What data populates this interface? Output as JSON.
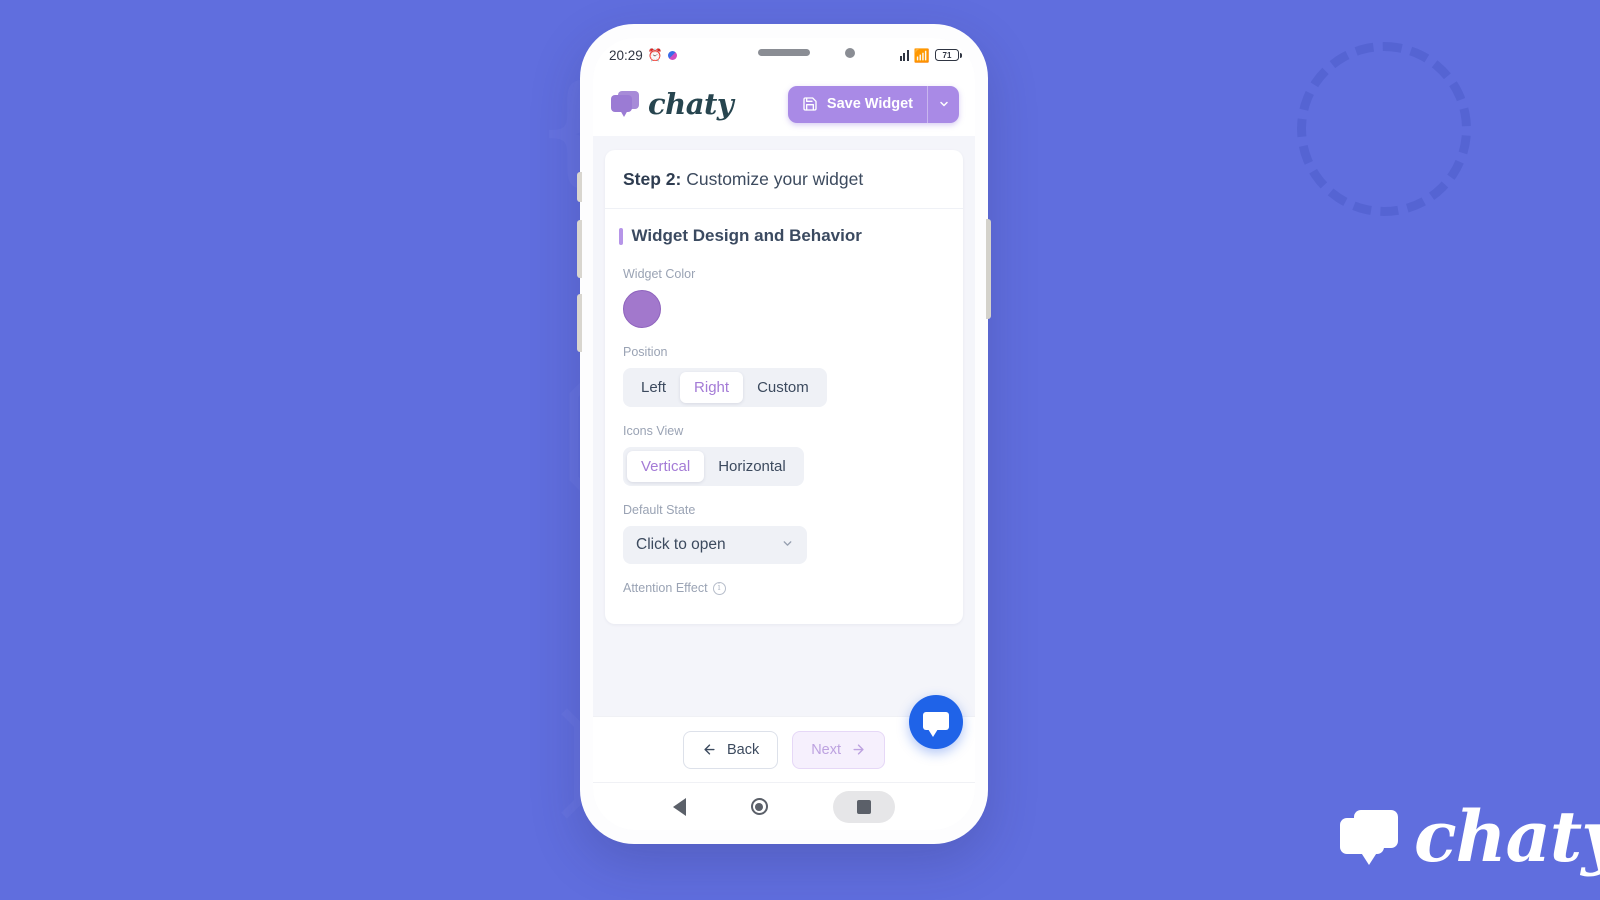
{
  "background": {
    "color": "#606EDE"
  },
  "watermark": {
    "brand": "chaty",
    "icon": "chat-bubble-icon"
  },
  "phone": {
    "status_bar": {
      "time": "20:29",
      "alarm_icon": "alarm-clock-icon",
      "notification_icon": "app-notification-icon",
      "signal_icon": "cellular-signal-icon",
      "wifi_icon": "wifi-icon",
      "battery_level": "71"
    },
    "app_header": {
      "brand": "chaty",
      "brand_icon": "chat-bubble-logo-icon",
      "save_label": "Save Widget",
      "save_icon": "floppy-disk-save-icon",
      "dropdown_icon": "chevron-down-icon",
      "accent_color": "#A98AE6"
    },
    "main": {
      "step_prefix": "Step 2:",
      "step_title": " Customize your widget",
      "section_title": "Widget Design and Behavior",
      "fields": {
        "widget_color": {
          "label": "Widget Color",
          "value": "#A278CC"
        },
        "position": {
          "label": "Position",
          "options": [
            "Left",
            "Right",
            "Custom"
          ],
          "selected": "Right"
        },
        "icons_view": {
          "label": "Icons View",
          "options": [
            "Vertical",
            "Horizontal"
          ],
          "selected": "Vertical"
        },
        "default_state": {
          "label": "Default State",
          "value": "Click to open",
          "caret_icon": "chevron-down-icon"
        },
        "attention_effect": {
          "label": "Attention Effect",
          "info_icon": "info-circle-icon"
        }
      }
    },
    "footer": {
      "back_label": "Back",
      "back_icon": "arrow-left-icon",
      "next_label": "Next",
      "next_icon": "arrow-right-icon",
      "fab_icon": "chat-bubble-icon",
      "fab_color": "#1F63E8"
    },
    "navbar": {
      "back_icon": "android-back-icon",
      "home_icon": "android-home-icon",
      "recents_icon": "android-recents-icon"
    }
  }
}
